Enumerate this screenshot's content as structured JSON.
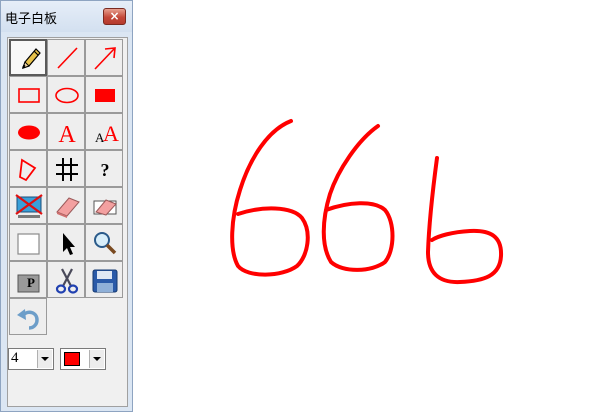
{
  "window": {
    "title": "电子白板",
    "close_glyph": "×"
  },
  "tools": [
    {
      "name": "pencil-tool",
      "icon": "pencil-icon",
      "selected": true
    },
    {
      "name": "line-tool",
      "icon": "line-icon"
    },
    {
      "name": "arrow-tool",
      "icon": "arrow-icon"
    },
    {
      "name": "rectangle-tool",
      "icon": "rectangle-outline-icon"
    },
    {
      "name": "ellipse-tool",
      "icon": "ellipse-outline-icon"
    },
    {
      "name": "filled-rectangle-tool",
      "icon": "rectangle-filled-icon"
    },
    {
      "name": "filled-ellipse-tool",
      "icon": "ellipse-filled-icon"
    },
    {
      "name": "text-tool",
      "icon": "text-icon",
      "glyph": "A"
    },
    {
      "name": "font-size-tool",
      "icon": "font-size-icon",
      "glyph_small": "A",
      "glyph_large": "A"
    },
    {
      "name": "polygon-tool",
      "icon": "polygon-icon"
    },
    {
      "name": "grid-tool",
      "icon": "grid-icon"
    },
    {
      "name": "help-tool",
      "icon": "help-icon",
      "glyph": "?"
    },
    {
      "name": "clear-screen-tool",
      "icon": "clear-screen-icon"
    },
    {
      "name": "eraser-tool",
      "icon": "eraser-icon"
    },
    {
      "name": "area-eraser-tool",
      "icon": "area-eraser-icon"
    },
    {
      "name": "select-area-tool",
      "icon": "select-area-icon"
    },
    {
      "name": "pointer-tool",
      "icon": "pointer-icon"
    },
    {
      "name": "zoom-tool",
      "icon": "magnifier-icon"
    },
    {
      "name": "paste-tool",
      "icon": "paste-icon",
      "glyph": "P"
    },
    {
      "name": "cut-tool",
      "icon": "scissors-icon"
    },
    {
      "name": "save-tool",
      "icon": "floppy-disk-icon"
    },
    {
      "name": "undo-tool",
      "icon": "undo-icon"
    }
  ],
  "controls": {
    "line_width": "4",
    "color": "#ff0000"
  },
  "colors": {
    "ink": "#ff0000",
    "window_frame": "#dbe6f3"
  }
}
